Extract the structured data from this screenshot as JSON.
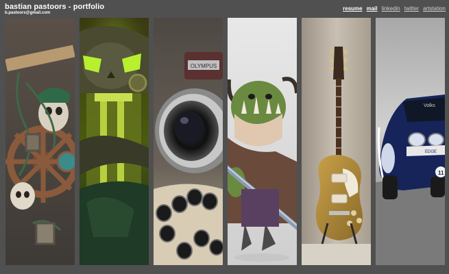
{
  "header": {
    "title": "bastian pastoors - portfolio",
    "email": "b.pastoors@gmail.com"
  },
  "nav": {
    "items": [
      {
        "label": "resume",
        "active": true
      },
      {
        "label": "mail",
        "active": true
      },
      {
        "label": "linkedin",
        "active": false
      },
      {
        "label": "twitter",
        "active": false
      },
      {
        "label": "artstation",
        "active": false
      }
    ]
  },
  "gallery": {
    "panels": [
      {
        "subject": "pirate skull ship wheel"
      },
      {
        "subject": "glowing green skull"
      },
      {
        "subject": "camera on tripod",
        "brand_text": "OLYMPUS"
      },
      {
        "subject": "orc warrior with sword"
      },
      {
        "subject": "gold electric guitar"
      },
      {
        "subject": "blue rally car"
      }
    ]
  },
  "colors": {
    "page_background": "#505050",
    "header_text": "#ffffff"
  }
}
